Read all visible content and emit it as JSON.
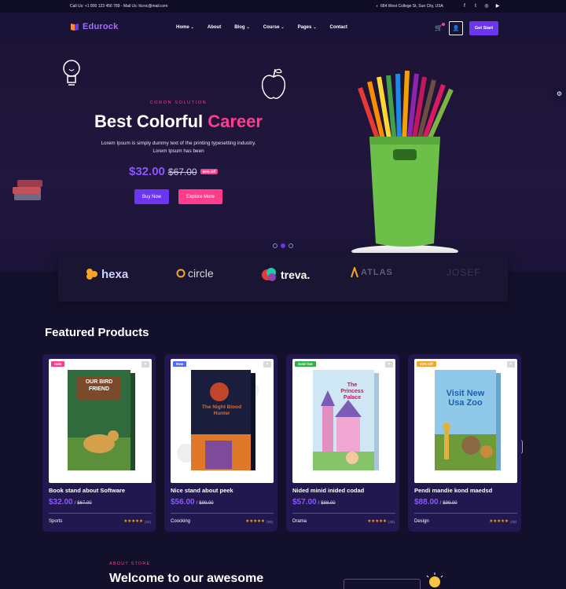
{
  "topbar": {
    "contact": "Call Us: +1 800 123 456 789 - Mail Us: ltcroc@mail.com",
    "address": "684 West College St, Sun City, USA",
    "social": [
      "facebook-icon",
      "twitter-icon",
      "instagram-icon",
      "youtube-icon"
    ]
  },
  "nav": {
    "logo": "Edurock",
    "menu": [
      {
        "label": "Home",
        "dropdown": true
      },
      {
        "label": "About",
        "dropdown": false
      },
      {
        "label": "Blog",
        "dropdown": true
      },
      {
        "label": "Course",
        "dropdown": true
      },
      {
        "label": "Pages",
        "dropdown": true
      },
      {
        "label": "Contact",
        "dropdown": false
      }
    ],
    "cta": "Get Start"
  },
  "hero": {
    "eyebrow": "CORON SOLUTION",
    "title_main": "Best Colorful ",
    "title_highlight": "Career",
    "description": "Lorem Ipsum is simply dummy text of the printing typesetting industry. Lorem Ipsum has been",
    "price": "$32.00",
    "old_price": "$67.00",
    "discount": "50% Off",
    "buy_label": "Buy Now",
    "explore_label": "Explore More",
    "slides": 3,
    "active_slide": 2
  },
  "brands": [
    "hexa",
    "circle",
    "treva.",
    "ATLAS",
    "JOSEF"
  ],
  "featured": {
    "title": "Featured Products",
    "products": [
      {
        "badge": "Sale",
        "badge_color": "#ff3d8b",
        "book_title": "OUR BIRD FRIEND",
        "title": "Book stand about Software",
        "price": "$32.00",
        "old_price": "$67.00",
        "category": "Sports",
        "rating": "(44)"
      },
      {
        "badge": "New",
        "badge_color": "#4f6bff",
        "book_title": "The Night Blood Hunter",
        "title": "Nice stand about peek",
        "price": "$56.00",
        "old_price": "$99.00",
        "category": "Coocking",
        "rating": "(56)"
      },
      {
        "badge": "Sold Out",
        "badge_color": "#2bb14a",
        "book_title": "The Princess Palace",
        "title": "Nided minid inided codad",
        "price": "$57.00",
        "old_price": "$88.00",
        "category": "Drama",
        "rating": "(45)"
      },
      {
        "badge": "20% Off",
        "badge_color": "#f5a623",
        "book_title": "Visit New Usa Zoo",
        "title": "Pendi mandie kond maedsd",
        "price": "$88.00",
        "old_price": "$99.00",
        "category": "Design",
        "rating": "(49)"
      }
    ]
  },
  "about": {
    "eyebrow": "ABOUT STORE",
    "title": "Welcome to our awesome"
  },
  "colors": {
    "accent_purple": "#6c35f2",
    "accent_pink": "#ff3d8b",
    "background": "#13102b"
  }
}
